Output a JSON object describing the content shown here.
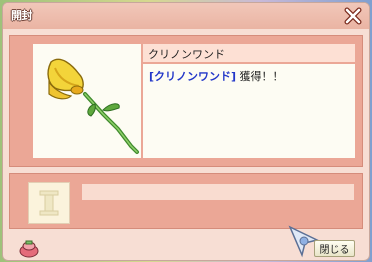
{
  "window": {
    "title": "開封",
    "close_icon": "close-x-icon"
  },
  "item": {
    "name": "クリノンワンド",
    "image_icon": "yellow-flower-wand-icon"
  },
  "message": {
    "tag": "[クリノンワンド]",
    "text": " 獲得！！"
  },
  "slot": {
    "icon": "slot-letter-i-icon"
  },
  "footer": {
    "icon": "pouch-icon",
    "cursor_icon": "pointer-cursor-icon",
    "close_button_label": "閉じる"
  },
  "colors": {
    "accent": "#eba796",
    "window_bg": "#f7ded4",
    "tag_blue": "#2337c9"
  }
}
